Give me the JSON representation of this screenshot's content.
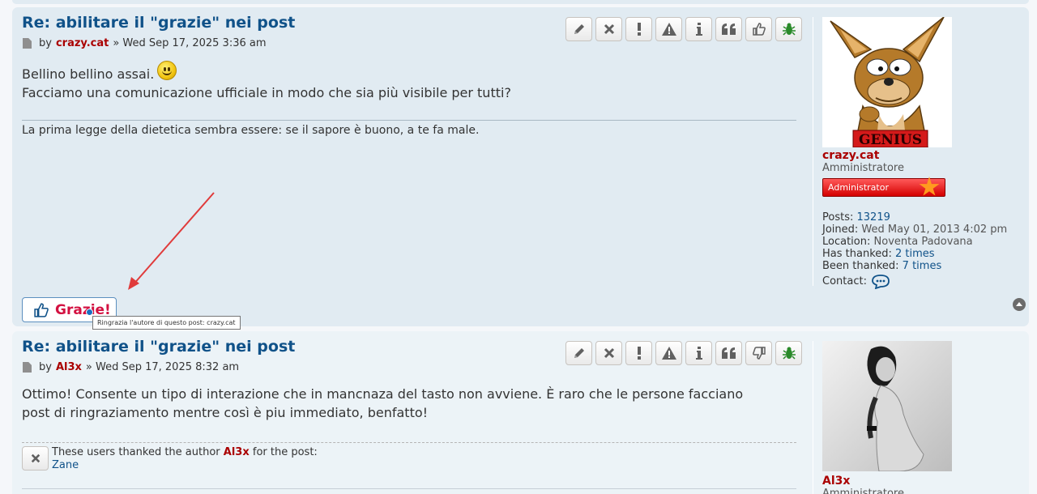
{
  "posts": [
    {
      "title": "Re: abilitare il \"grazie\" nei post",
      "by_label": "by",
      "author": "crazy.cat",
      "date": "» Wed Sep 17, 2025 3:36 am",
      "content_line1": "Bellino bellino assai.",
      "content_line2": "Facciamo una comunicazione ufficiale in modo che sia più visibile per tutti?",
      "signature": "La prima legge della dietetica sembra essere: se il sapore è buono, a te fa male.",
      "profile": {
        "username": "crazy.cat",
        "rank": "Amministratore",
        "rank_badge": "Administrator",
        "avatar_text": "GENIUS",
        "posts_label": "Posts:",
        "posts_value": "13219",
        "joined_label": "Joined:",
        "joined_value": "Wed May 01, 2013 4:02 pm",
        "location_label": "Location:",
        "location_value": "Noventa Padovana",
        "has_thanked_label": "Has thanked:",
        "has_thanked_value": "2 times",
        "been_thanked_label": "Been thanked:",
        "been_thanked_value": "7 times",
        "contact_label": "Contact:"
      },
      "thanks_button": "Grazie!",
      "tooltip": "Ringrazia l'autore di questo post: crazy.cat"
    },
    {
      "title": "Re: abilitare il \"grazie\" nei post",
      "by_label": "by",
      "author": "Al3x",
      "date": "» Wed Sep 17, 2025 8:32 am",
      "content": "Ottimo! Consente un tipo di interazione che in mancnaza del tasto non avviene. È raro che le persone facciano post di ringraziamento mentre così è piu immediato, benfatto!",
      "thanked_prefix": "These users thanked the author",
      "thanked_author": "Al3x",
      "thanked_suffix": "for the post:",
      "thanked_users": [
        "Zane"
      ],
      "profile": {
        "username": "Al3x",
        "rank": "Amministratore"
      }
    }
  ],
  "colors": {
    "title": "#105289",
    "author": "#aa0000",
    "thanks_text": "#d31141",
    "post_bg_1": "#e1ebf2",
    "post_bg_2": "#ecf3f7",
    "arrow": "#e03b3b"
  },
  "post_buttons": [
    "edit-icon",
    "delete-icon",
    "report-icon",
    "warn-icon",
    "info-icon",
    "quote-icon",
    "thumbs-icon",
    "bug-icon"
  ]
}
